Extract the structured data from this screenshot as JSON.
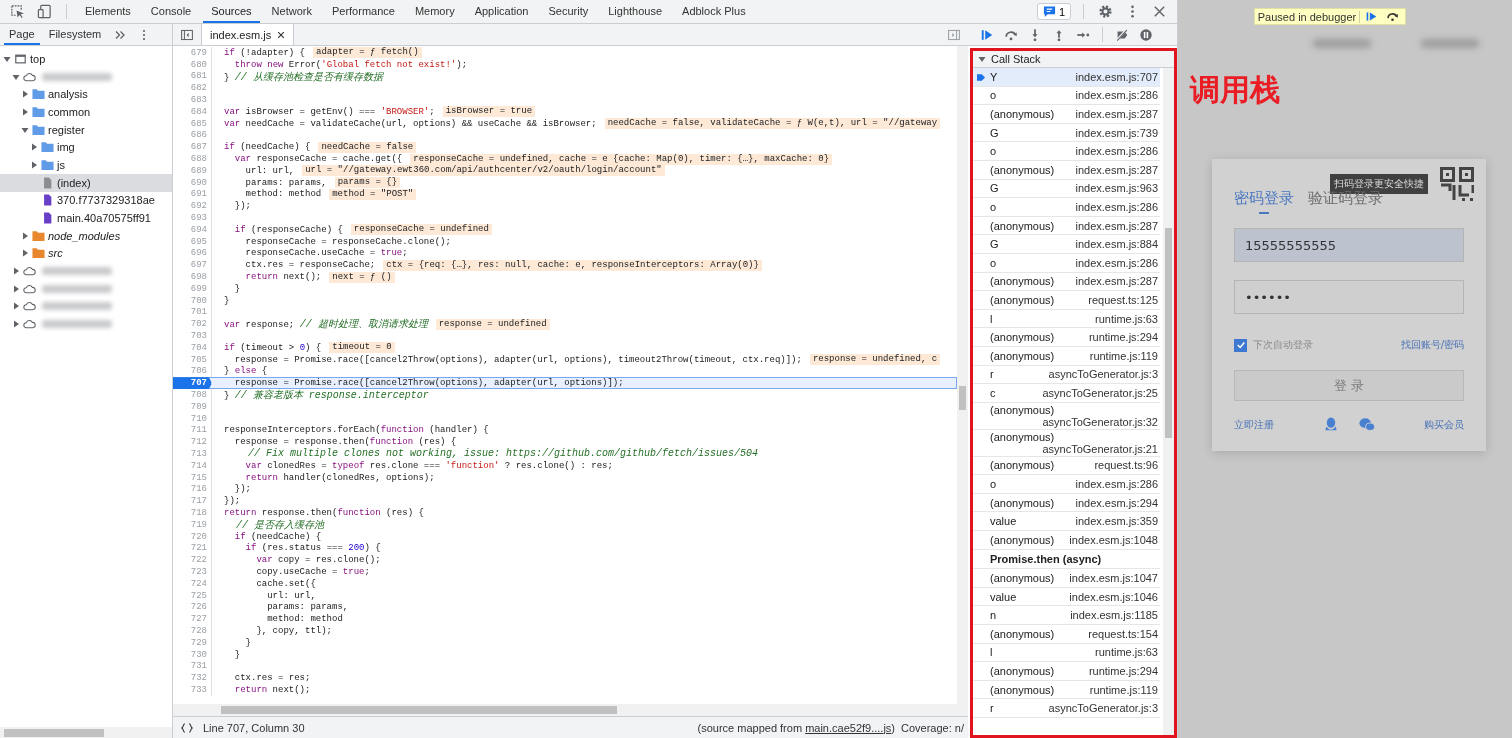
{
  "toolbar": {
    "tabs": [
      {
        "label": "Elements",
        "selected": false
      },
      {
        "label": "Console",
        "selected": false
      },
      {
        "label": "Sources",
        "selected": true
      },
      {
        "label": "Network",
        "selected": false
      },
      {
        "label": "Performance",
        "selected": false
      },
      {
        "label": "Memory",
        "selected": false
      },
      {
        "label": "Application",
        "selected": false
      },
      {
        "label": "Security",
        "selected": false
      },
      {
        "label": "Lighthouse",
        "selected": false
      },
      {
        "label": "Adblock Plus",
        "selected": false
      }
    ],
    "issues_count": "1"
  },
  "sidebar": {
    "tabs": [
      {
        "label": "Page",
        "selected": true
      },
      {
        "label": "Filesystem",
        "selected": false
      }
    ],
    "tree": [
      {
        "kind": "frame",
        "label": "top",
        "expanded": true,
        "selected": false,
        "children": [
          {
            "kind": "domain",
            "expanded": true,
            "selected": false,
            "children": [
              {
                "kind": "folder",
                "label": "analysis",
                "expanded": false,
                "selected": false
              },
              {
                "kind": "folder",
                "label": "common",
                "expanded": false,
                "selected": false
              },
              {
                "kind": "folder",
                "label": "register",
                "expanded": true,
                "selected": false,
                "children": [
                  {
                    "kind": "folder",
                    "label": "img",
                    "expanded": false,
                    "selected": false
                  },
                  {
                    "kind": "folder",
                    "label": "js",
                    "expanded": false,
                    "selected": false
                  },
                  {
                    "kind": "file",
                    "label": "(index)",
                    "selected": true
                  },
                  {
                    "kind": "script",
                    "label": "370.f7737329318ae",
                    "selected": false
                  },
                  {
                    "kind": "script",
                    "label": "main.40a70575ff91",
                    "selected": false
                  }
                ]
              },
              {
                "kind": "mapped-folder",
                "label": "node_modules",
                "expanded": false,
                "selected": false
              },
              {
                "kind": "mapped-folder",
                "label": "src",
                "expanded": false,
                "selected": false
              }
            ]
          },
          {
            "kind": "domain",
            "expanded": false,
            "selected": false
          },
          {
            "kind": "domain",
            "expanded": false,
            "selected": false
          },
          {
            "kind": "domain",
            "expanded": false,
            "selected": false
          },
          {
            "kind": "domain",
            "expanded": false,
            "selected": false
          }
        ]
      }
    ]
  },
  "editor": {
    "file_tab": {
      "label": "index.esm.js"
    },
    "lines": [
      {
        "number": "679",
        "code": "if (!adapter) {",
        "value": "adapter = ƒ fetch()",
        "current": false
      },
      {
        "number": "680",
        "code": "  throw new Error('Global fetch not exist!');",
        "current": false
      },
      {
        "number": "681",
        "code": "} ",
        "comment": "// 从缓存池检查是否有缓存数据",
        "current": false
      },
      {
        "number": "682",
        "current": false
      },
      {
        "number": "683",
        "current": false
      },
      {
        "number": "684",
        "code": "var isBrowser = getEnv() === 'BROWSER';",
        "value": "isBrowser = true",
        "current": false
      },
      {
        "number": "685",
        "code": "var needCache = validateCache(url, options) && useCache && isBrowser;",
        "value": "needCache = false, validateCache = ƒ W(e,t), url = \"//gateway",
        "current": false
      },
      {
        "number": "686",
        "current": false
      },
      {
        "number": "687",
        "code": "if (needCache) {",
        "value": "needCache = false",
        "current": false
      },
      {
        "number": "688",
        "code": "  var responseCache = cache.get({",
        "value": "responseCache = undefined, cache = e {cache: Map(0), timer: {…}, maxCache: 0}",
        "current": false
      },
      {
        "number": "689",
        "code": "    url: url,",
        "value": "url = \"//gateway.ewt360.com/api/authcenter/v2/oauth/login/account\"",
        "current": false
      },
      {
        "number": "690",
        "code": "    params: params,",
        "value": "params = {}",
        "current": false
      },
      {
        "number": "691",
        "code": "    method: method",
        "value": "method = \"POST\"",
        "current": false
      },
      {
        "number": "692",
        "code": "  });",
        "current": false
      },
      {
        "number": "693",
        "current": false
      },
      {
        "number": "694",
        "code": "  if (responseCache) {",
        "value": "responseCache = undefined",
        "current": false
      },
      {
        "number": "695",
        "code": "    responseCache = responseCache.clone();",
        "current": false
      },
      {
        "number": "696",
        "code": "    responseCache.useCache = true;",
        "current": false
      },
      {
        "number": "697",
        "code": "    ctx.res = responseCache;",
        "value": "ctx = {req: {…}, res: null, cache: e, responseInterceptors: Array(0)}",
        "current": false
      },
      {
        "number": "698",
        "code": "    return next();",
        "value": "next = ƒ ()",
        "current": false
      },
      {
        "number": "699",
        "code": "  }",
        "current": false
      },
      {
        "number": "700",
        "code": "}",
        "current": false
      },
      {
        "number": "701",
        "current": false
      },
      {
        "number": "702",
        "code": "var response; ",
        "comment": "// 超时处理、取消请求处理",
        "value": "response = undefined",
        "current": false
      },
      {
        "number": "703",
        "current": false
      },
      {
        "number": "704",
        "code": "if (timeout > 0) {",
        "value": "timeout = 0",
        "current": false
      },
      {
        "number": "705",
        "code": "  response = Promise.race([cancel2Throw(options), adapter(url, options), timeout2Throw(timeout, ctx.req)]);",
        "value": "response = undefined, c",
        "current": false
      },
      {
        "number": "706",
        "code": "} else {",
        "current": false
      },
      {
        "number": "707",
        "code": "  response = Promise.race([cancel2Throw(options), adapter(url, options)]);",
        "current": true
      },
      {
        "number": "708",
        "code": "} ",
        "comment": "// 兼容老版本 response.interceptor",
        "current": false
      },
      {
        "number": "709",
        "current": false
      },
      {
        "number": "710",
        "current": false
      },
      {
        "number": "711",
        "code": "responseInterceptors.forEach(function (handler) {",
        "current": false
      },
      {
        "number": "712",
        "code": "  response = response.then(function (res) {",
        "current": false
      },
      {
        "number": "713",
        "comment": "    // Fix multiple clones not working, issue: https://github.com/github/fetch/issues/504",
        "current": false
      },
      {
        "number": "714",
        "code": "    var clonedRes = typeof res.clone === 'function' ? res.clone() : res;",
        "current": false
      },
      {
        "number": "715",
        "code": "    return handler(clonedRes, options);",
        "current": false
      },
      {
        "number": "716",
        "code": "  });",
        "current": false
      },
      {
        "number": "717",
        "code": "});",
        "current": false
      },
      {
        "number": "718",
        "code": "return response.then(function (res) {",
        "current": false
      },
      {
        "number": "719",
        "comment": "  // 是否存入缓存池",
        "current": false
      },
      {
        "number": "720",
        "code": "  if (needCache) {",
        "current": false
      },
      {
        "number": "721",
        "code": "    if (res.status === 200) {",
        "current": false
      },
      {
        "number": "722",
        "code": "      var copy = res.clone();",
        "current": false
      },
      {
        "number": "723",
        "code": "      copy.useCache = true;",
        "current": false
      },
      {
        "number": "724",
        "code": "      cache.set({",
        "current": false
      },
      {
        "number": "725",
        "code": "        url: url,",
        "current": false
      },
      {
        "number": "726",
        "code": "        params: params,",
        "current": false
      },
      {
        "number": "727",
        "code": "        method: method",
        "current": false
      },
      {
        "number": "728",
        "code": "      }, copy, ttl);",
        "current": false
      },
      {
        "number": "729",
        "code": "    }",
        "current": false
      },
      {
        "number": "730",
        "code": "  }",
        "current": false
      },
      {
        "number": "731",
        "current": false
      },
      {
        "number": "732",
        "code": "  ctx.res = res;",
        "current": false
      },
      {
        "number": "733",
        "code": "  return next();",
        "current": false
      }
    ]
  },
  "status_bar": {
    "position": "Line 707, Column 30",
    "source_prefix": "(source mapped from ",
    "source_link": "main.cae52f9....js",
    "source_suffix": ")",
    "coverage": "Coverage: n/"
  },
  "call_stack": {
    "title": "Call Stack",
    "expanded": true,
    "frames": [
      {
        "kind": "frame",
        "name": "Y",
        "location": "index.esm.js:707",
        "selected": true
      },
      {
        "kind": "frame",
        "name": "o",
        "location": "index.esm.js:286",
        "selected": false
      },
      {
        "kind": "frame",
        "name": "(anonymous)",
        "location": "index.esm.js:287",
        "selected": false
      },
      {
        "kind": "frame",
        "name": "G",
        "location": "index.esm.js:739",
        "selected": false
      },
      {
        "kind": "frame",
        "name": "o",
        "location": "index.esm.js:286",
        "selected": false
      },
      {
        "kind": "frame",
        "name": "(anonymous)",
        "location": "index.esm.js:287",
        "selected": false
      },
      {
        "kind": "frame",
        "name": "G",
        "location": "index.esm.js:963",
        "selected": false
      },
      {
        "kind": "frame",
        "name": "o",
        "location": "index.esm.js:286",
        "selected": false
      },
      {
        "kind": "frame",
        "name": "(anonymous)",
        "location": "index.esm.js:287",
        "selected": false
      },
      {
        "kind": "frame",
        "name": "G",
        "location": "index.esm.js:884",
        "selected": false
      },
      {
        "kind": "frame",
        "name": "o",
        "location": "index.esm.js:286",
        "selected": false
      },
      {
        "kind": "frame",
        "name": "(anonymous)",
        "location": "index.esm.js:287",
        "selected": false
      },
      {
        "kind": "frame",
        "name": "(anonymous)",
        "location": "request.ts:125",
        "selected": false
      },
      {
        "kind": "frame",
        "name": "l",
        "location": "runtime.js:63",
        "selected": false
      },
      {
        "kind": "frame",
        "name": "(anonymous)",
        "location": "runtime.js:294",
        "selected": false
      },
      {
        "kind": "frame",
        "name": "(anonymous)",
        "location": "runtime.js:119",
        "selected": false
      },
      {
        "kind": "frame",
        "name": "r",
        "location": "asyncToGenerator.js:3",
        "selected": false
      },
      {
        "kind": "frame",
        "name": "c",
        "location": "asyncToGenerator.js:25",
        "selected": false
      },
      {
        "kind": "frame",
        "name": "(anonymous)",
        "location": "asyncToGenerator.js:32",
        "selected": false
      },
      {
        "kind": "frame",
        "name": "(anonymous)",
        "location": "asyncToGenerator.js:21",
        "selected": false
      },
      {
        "kind": "frame",
        "name": "(anonymous)",
        "location": "request.ts:96",
        "selected": false
      },
      {
        "kind": "frame",
        "name": "o",
        "location": "index.esm.js:286",
        "selected": false
      },
      {
        "kind": "frame",
        "name": "(anonymous)",
        "location": "index.esm.js:294",
        "selected": false
      },
      {
        "kind": "frame",
        "name": "value",
        "location": "index.esm.js:359",
        "selected": false
      },
      {
        "kind": "frame",
        "name": "(anonymous)",
        "location": "index.esm.js:1048",
        "selected": false
      },
      {
        "kind": "async",
        "name": "Promise.then (async)"
      },
      {
        "kind": "frame",
        "name": "(anonymous)",
        "location": "index.esm.js:1047",
        "selected": false
      },
      {
        "kind": "frame",
        "name": "value",
        "location": "index.esm.js:1046",
        "selected": false
      },
      {
        "kind": "frame",
        "name": "n",
        "location": "index.esm.js:1185",
        "selected": false
      },
      {
        "kind": "frame",
        "name": "(anonymous)",
        "location": "request.ts:154",
        "selected": false
      },
      {
        "kind": "frame",
        "name": "l",
        "location": "runtime.js:63",
        "selected": false
      },
      {
        "kind": "frame",
        "name": "(anonymous)",
        "location": "runtime.js:294",
        "selected": false
      },
      {
        "kind": "frame",
        "name": "(anonymous)",
        "location": "runtime.js:119",
        "selected": false
      },
      {
        "kind": "frame",
        "name": "r",
        "location": "asyncToGenerator.js:3",
        "selected": false
      }
    ]
  },
  "annotation": {
    "label": "调用栈"
  },
  "page": {
    "debugger_banner": {
      "label": "Paused in debugger"
    },
    "login": {
      "tooltip": "扫码登录更安全快捷",
      "tabs": [
        {
          "label": "密码登录",
          "selected": true
        },
        {
          "label": "验证码登录",
          "selected": false
        }
      ],
      "phone": {
        "value": "15555555555"
      },
      "password": {
        "value": "••••••"
      },
      "remember": {
        "label": "下次自动登录",
        "checked": true
      },
      "forgot_link": "找回账号/密码",
      "submit": {
        "label": "登 录",
        "disabled": true
      },
      "register_link": "立即注册",
      "buy_link": "购买会员"
    }
  }
}
